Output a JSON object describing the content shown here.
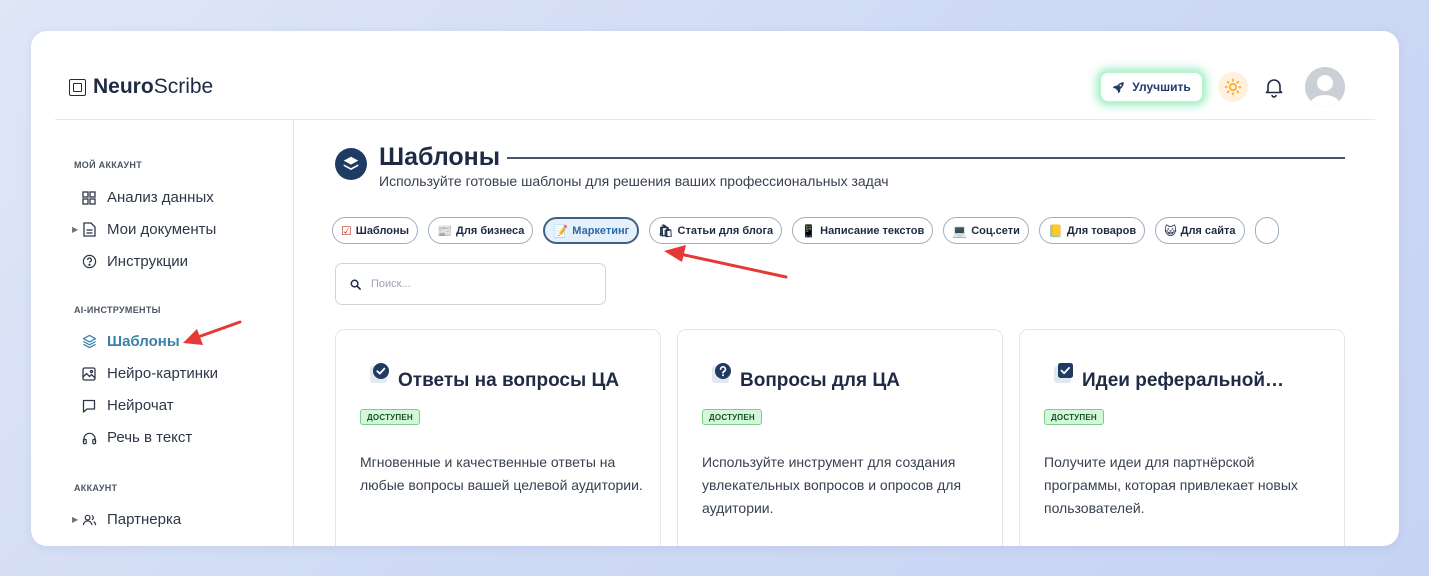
{
  "app": {
    "brand_bold": "Neuro",
    "brand_regular": "Scribe"
  },
  "header": {
    "upgrade_label": "Улучшить",
    "icons": [
      "rocket-icon",
      "sun-icon",
      "bell-icon",
      "avatar"
    ]
  },
  "sidebar": {
    "sections": [
      {
        "title": "МОЙ АККАУНТ",
        "items": [
          {
            "label": "Анализ данных",
            "icon": "grid-icon"
          },
          {
            "label": "Мои документы",
            "icon": "document-icon",
            "expandable": true
          },
          {
            "label": "Инструкции",
            "icon": "help-icon"
          }
        ]
      },
      {
        "title": "AI-ИНСТРУМЕНТЫ",
        "items": [
          {
            "label": "Шаблоны",
            "icon": "layers-icon",
            "active": true
          },
          {
            "label": "Нейро-картинки",
            "icon": "image-icon"
          },
          {
            "label": "Нейрочат",
            "icon": "chat-icon"
          },
          {
            "label": "Речь в текст",
            "icon": "headphones-icon"
          }
        ]
      },
      {
        "title": "АККАУНТ",
        "items": [
          {
            "label": "Партнерка",
            "icon": "users-icon",
            "expandable": true
          }
        ]
      }
    ]
  },
  "main": {
    "title": "Шаблоны",
    "subtitle": "Используйте готовые шаблоны для решения ваших профессиональных задач",
    "search_placeholder": "Поиск...",
    "chips": [
      {
        "emoji": "☑",
        "label": "Шаблоны"
      },
      {
        "emoji": "📰",
        "label": "Для бизнеса"
      },
      {
        "emoji": "📝",
        "label": "Маркетинг",
        "active": true
      },
      {
        "emoji": "🛍",
        "label": "Статьи для блога"
      },
      {
        "emoji": "📱",
        "label": "Написание текстов"
      },
      {
        "emoji": "💻",
        "label": "Соц.сети"
      },
      {
        "emoji": "📒",
        "label": "Для товаров"
      },
      {
        "emoji": "😺",
        "label": "Для сайта"
      }
    ],
    "cards": [
      {
        "icon": "check-badge-icon",
        "title": "Ответы на вопросы ЦА",
        "badge": "ДОСТУПЕН",
        "description": "Мгновенные и качественные ответы на любые вопросы вашей целевой аудитории."
      },
      {
        "icon": "question-badge-icon",
        "title": "Вопросы для ЦА",
        "badge": "ДОСТУПЕН",
        "description": "Используйте инструмент для создания увлекательных вопросов и опросов для аудитории."
      },
      {
        "icon": "checkbox-icon",
        "title": "Идеи реферальной…",
        "badge": "ДОСТУПЕН",
        "description": "Получите идеи для партнёрской программы, которая привлекает новых пользователей."
      }
    ]
  },
  "colors": {
    "accent": "#3b82a8",
    "dark": "#1f3a63",
    "badge_bg": "#d6f6d9",
    "annotation_arrow": "#e53935"
  }
}
